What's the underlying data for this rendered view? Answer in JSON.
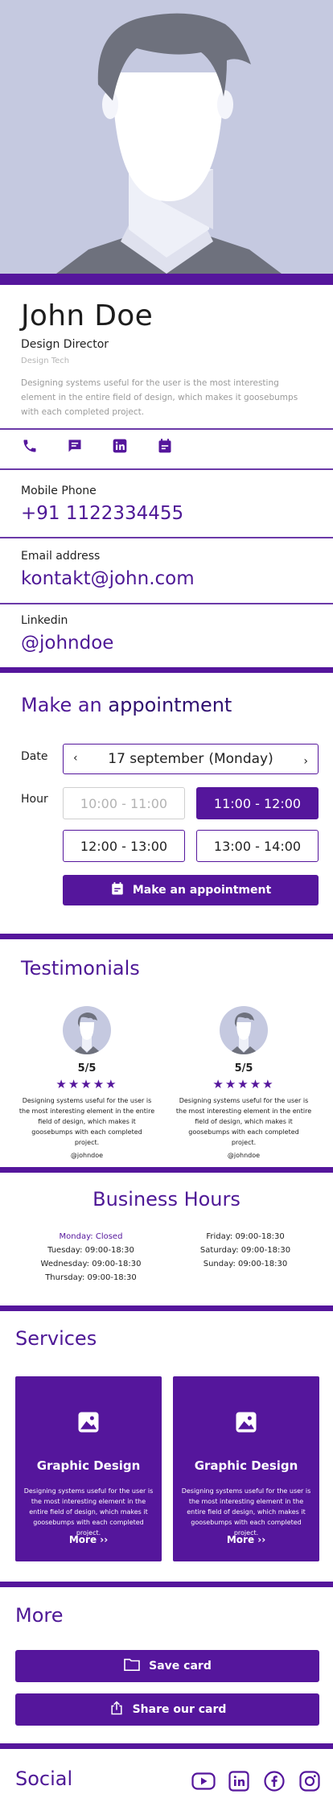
{
  "profile": {
    "name": "John Doe",
    "role": "Design Director",
    "company": "Design Tech",
    "bio": "Designing systems useful for the user is the most interesting element in the entire field of design, which makes it goosebumps with each completed project."
  },
  "quick_icons": [
    "phone-icon",
    "chat-icon",
    "linkedin-icon",
    "calendar-icon"
  ],
  "contacts": {
    "phone": {
      "label": "Mobile Phone",
      "value": "+91 1122334455"
    },
    "email": {
      "label": "Email address",
      "value": "kontakt@john.com"
    },
    "linkedin": {
      "label": "Linkedin",
      "value": "@johndoe"
    }
  },
  "appointment": {
    "title_prefix": "Make an",
    "title_bold": "appointment",
    "date_label": "Date",
    "date_value": "17 september",
    "date_day": "(Monday)",
    "prev_arrow": "‹",
    "next_arrow": "›",
    "hour_label": "Hour",
    "slots": [
      {
        "label": "10:00 - 11:00",
        "state": "disabled"
      },
      {
        "label": "11:00 - 12:00",
        "state": "selected"
      },
      {
        "label": "12:00 - 13:00",
        "state": "available"
      },
      {
        "label": "13:00 - 14:00",
        "state": "available"
      }
    ],
    "button_label": "Make an appointment"
  },
  "testimonials": {
    "title": "Testimonials",
    "items": [
      {
        "rating": "5/5",
        "stars": "★★★★★",
        "text": "Designing systems useful for the user is the most interesting element in the entire field of design, which makes it goosebumps with each completed project.",
        "handle": "@johndoe"
      },
      {
        "rating": "5/5",
        "stars": "★★★★★",
        "text": "Designing systems useful for the user is the most interesting element in the entire field of design, which makes it goosebumps with each completed project.",
        "handle": "@johndoe"
      }
    ]
  },
  "business_hours": {
    "title": "Business Hours",
    "left": [
      "Monday: Closed",
      "Tuesday: 09:00-18:30",
      "Wednesday: 09:00-18:30",
      "Thursday: 09:00-18:30"
    ],
    "right": [
      "Friday: 09:00-18:30",
      "Saturday: 09:00-18:30",
      "Sunday: 09:00-18:30"
    ]
  },
  "services": {
    "title": "Services",
    "items": [
      {
        "title": "Graphic Design",
        "text": "Designing systems useful for the user is the most interesting element in the entire field of design, which makes it goosebumps with each completed project.",
        "more": "More ››"
      },
      {
        "title": "Graphic Design",
        "text": "Designing systems useful for the user is the most interesting element in the entire field of design, which makes it goosebumps with each completed project.",
        "more": "More ››"
      }
    ]
  },
  "more": {
    "title": "More",
    "save_label": "Save card",
    "share_label": "Share our card"
  },
  "social": {
    "title": "Social",
    "icons": [
      "youtube-icon",
      "linkedin-icon",
      "facebook-icon",
      "instagram-icon"
    ]
  },
  "colors": {
    "accent": "#55169c",
    "hero_bg": "#c5c9e0",
    "muted_text": "#9a9a9a"
  }
}
